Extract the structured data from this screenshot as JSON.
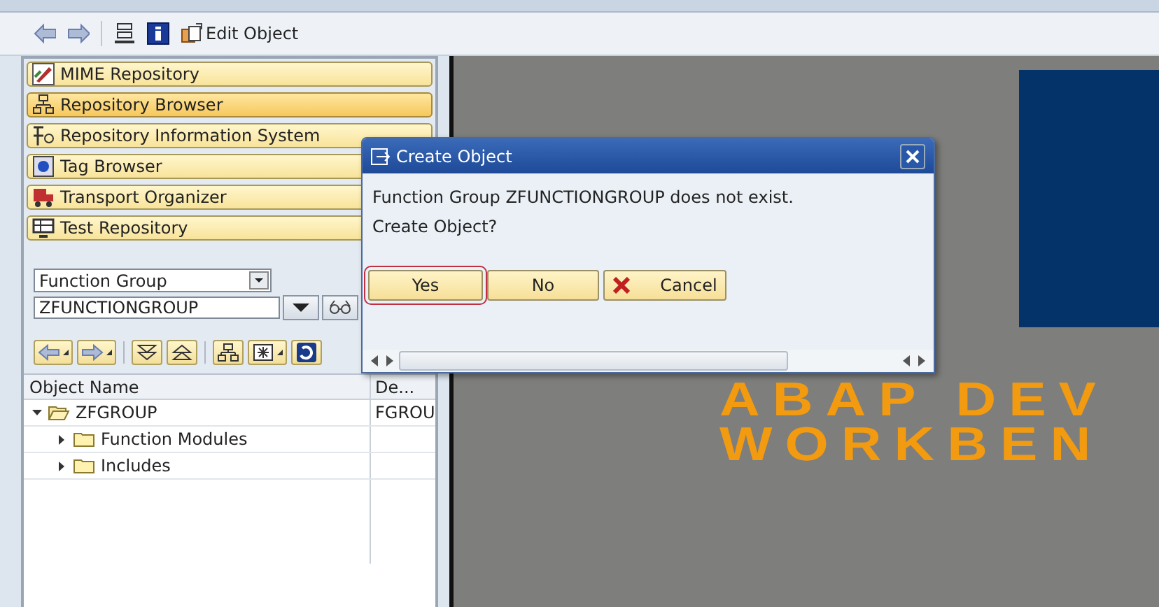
{
  "toolbar": {
    "edit_object": "Edit Object"
  },
  "navigator": [
    {
      "label": "MIME Repository",
      "selected": false
    },
    {
      "label": "Repository Browser",
      "selected": true
    },
    {
      "label": "Repository Information System",
      "selected": false
    },
    {
      "label": "Tag Browser",
      "selected": false
    },
    {
      "label": "Transport Organizer",
      "selected": false
    },
    {
      "label": "Test Repository",
      "selected": false
    }
  ],
  "object_type": {
    "value": "Function Group"
  },
  "object_name": {
    "value": "ZFUNCTIONGROUP"
  },
  "tree": {
    "columns": [
      "Object Name",
      "De..."
    ],
    "rows": [
      {
        "name": "ZFGROUP",
        "column_2": "FGROU",
        "expanded": true,
        "children": [
          {
            "name": "Function Modules",
            "expanded": false
          },
          {
            "name": "Includes",
            "expanded": false
          }
        ]
      }
    ]
  },
  "splash": {
    "lines": [
      "ABAP DEV",
      "WORKBEN"
    ]
  },
  "dialog": {
    "title": "Create Object",
    "message": [
      "Function Group ZFUNCTIONGROUP does not exist.",
      "Create Object?"
    ],
    "buttons": [
      {
        "label": "Yes",
        "kind": "focused"
      },
      {
        "label": "No",
        "kind": "plain"
      },
      {
        "label": "Cancel",
        "kind": "cancel"
      }
    ]
  }
}
